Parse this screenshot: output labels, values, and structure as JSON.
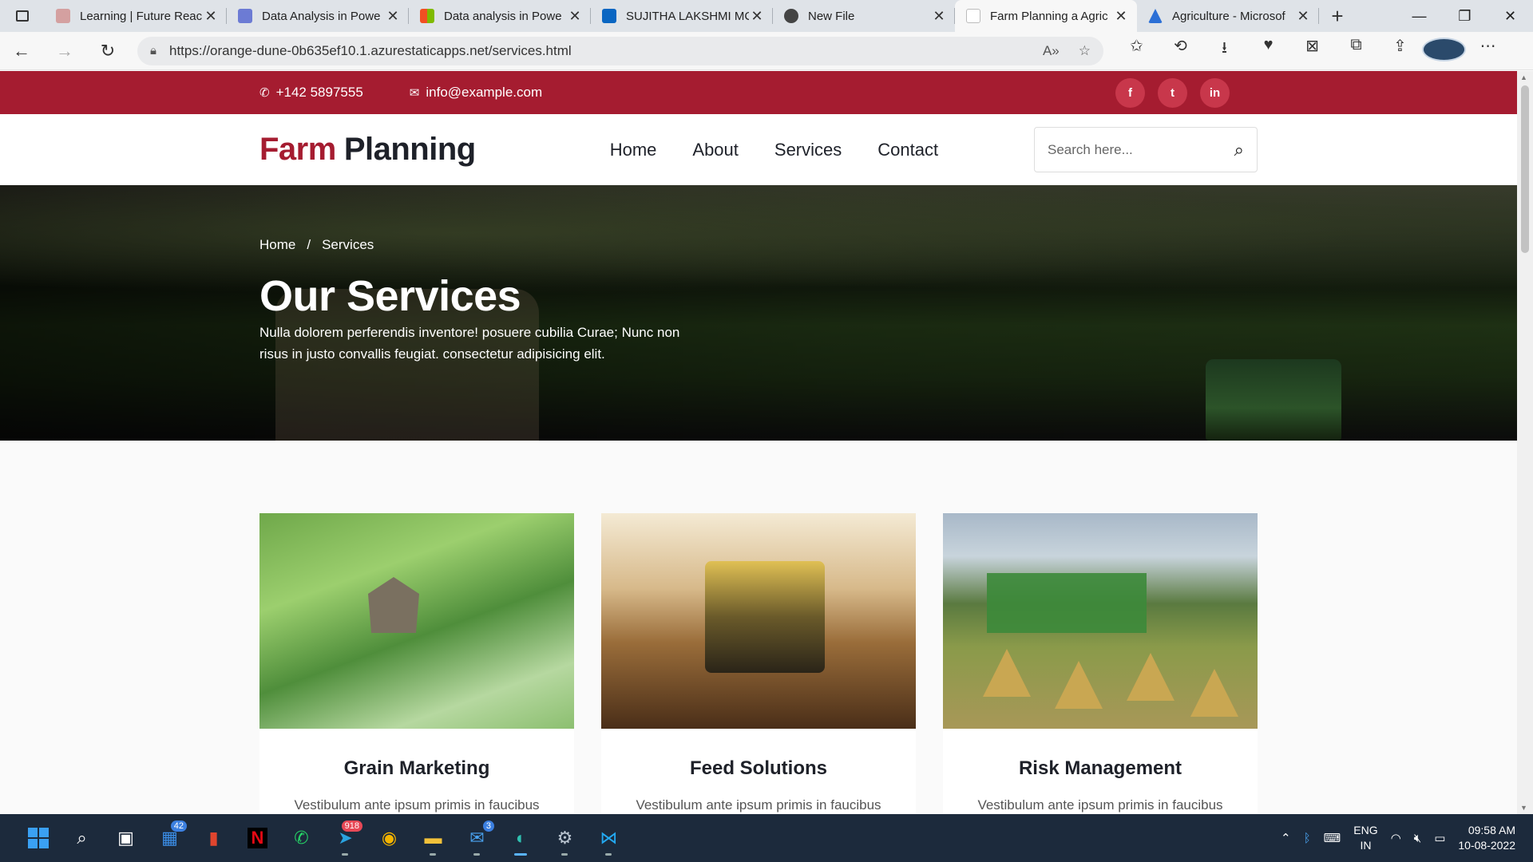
{
  "browser": {
    "tabs": [
      {
        "title": "Learning | Future Reac",
        "favicon_color": "#d4a0a0",
        "active": false
      },
      {
        "title": "Data Analysis in Powe",
        "favicon_color": "#6c7bd4",
        "active": false
      },
      {
        "title": "Data analysis in Powe",
        "favicon_color": "#f25022",
        "active": false
      },
      {
        "title": "SUJITHA LAKSHMI MC",
        "favicon_color": "#0a66c2",
        "active": false
      },
      {
        "title": "New File",
        "favicon_color": "#444444",
        "active": false
      },
      {
        "title": "Farm Planning a Agric",
        "favicon_color": "#ffffff",
        "active": true
      },
      {
        "title": "Agriculture - Microsof",
        "favicon_color": "#2b6fd6",
        "active": false
      }
    ],
    "url": "https://orange-dune-0b635ef10.1.azurestaticapps.net/services.html"
  },
  "site": {
    "phone": "+142 5897555",
    "email": "info@example.com",
    "social": [
      "f",
      "t",
      "in"
    ],
    "logo_part1": "Farm",
    "logo_part2": "Planning",
    "menu": [
      "Home",
      "About",
      "Services",
      "Contact"
    ],
    "search_placeholder": "Search here...",
    "breadcrumb": {
      "home": "Home",
      "separator": "/",
      "current": "Services"
    },
    "hero_title": "Our Services",
    "hero_text": "Nulla dolorem perferendis inventore! posuere cubilia Curae; Nunc non risus in justo convallis feugiat. consectetur adipisicing elit.",
    "cards": [
      {
        "title": "Grain Marketing",
        "desc": "Vestibulum ante ipsum primis in faucibus"
      },
      {
        "title": "Feed Solutions",
        "desc": "Vestibulum ante ipsum primis in faucibus"
      },
      {
        "title": "Risk Management",
        "desc": "Vestibulum ante ipsum primis in faucibus"
      }
    ],
    "colors": {
      "brand": "#a51c30",
      "dark": "#1e2129"
    }
  },
  "taskbar": {
    "badges": {
      "mail_app": "42",
      "telegram": "918",
      "outlook": "3"
    },
    "lang1": "ENG",
    "lang2": "IN",
    "time": "09:58 AM",
    "date": "10-08-2022"
  }
}
